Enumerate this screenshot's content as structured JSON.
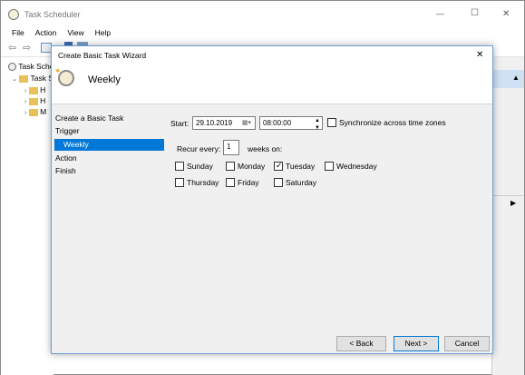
{
  "window": {
    "title": "Task Scheduler",
    "minimize": "—",
    "maximize": "☐",
    "close": "✕"
  },
  "menu": [
    "File",
    "Action",
    "View",
    "Help"
  ],
  "tree": {
    "root": "Task Sche",
    "library": "Task S",
    "folders": [
      "H",
      "H",
      "M"
    ]
  },
  "dialog": {
    "title": "Create Basic Task Wizard",
    "close": "✕",
    "header_title": "Weekly",
    "steps": [
      {
        "label": "Create a Basic Task",
        "selected": false
      },
      {
        "label": "Trigger",
        "selected": false
      },
      {
        "label": "Weekly",
        "selected": true
      },
      {
        "label": "Action",
        "selected": false
      },
      {
        "label": "Finish",
        "selected": false
      }
    ],
    "start_label": "Start:",
    "start_date": "29.10.2019",
    "start_time": "08:00:00",
    "sync_label": "Synchronize across time zones",
    "sync_checked": false,
    "recur_label": "Recur every:",
    "recur_value": "1",
    "weeks_on": "weeks on:",
    "days": [
      {
        "label": "Sunday",
        "checked": false
      },
      {
        "label": "Monday",
        "checked": false
      },
      {
        "label": "Tuesday",
        "checked": true
      },
      {
        "label": "Wednesday",
        "checked": false
      },
      {
        "label": "Thursday",
        "checked": false
      },
      {
        "label": "Friday",
        "checked": false
      },
      {
        "label": "Saturday",
        "checked": false
      }
    ],
    "back_button": "< Back",
    "next_button": "Next >",
    "cancel_button": "Cancel"
  },
  "colors": {
    "selection": "#0078d7",
    "dialog_bg": "#f0f0f0",
    "button_border_default": "#0078d7"
  }
}
